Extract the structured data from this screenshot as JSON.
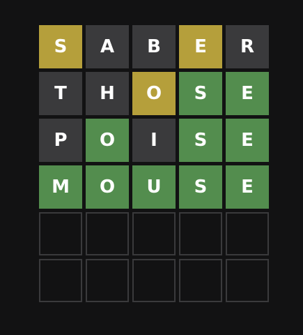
{
  "colors": {
    "correct": "#538d4e",
    "present": "#b59f3b",
    "absent": "#3a3a3c",
    "background": "#121213",
    "empty_border": "#3a3a3c"
  },
  "board": {
    "rows": [
      [
        {
          "letter": "S",
          "state": "present"
        },
        {
          "letter": "A",
          "state": "absent"
        },
        {
          "letter": "B",
          "state": "absent"
        },
        {
          "letter": "E",
          "state": "present"
        },
        {
          "letter": "R",
          "state": "absent"
        }
      ],
      [
        {
          "letter": "T",
          "state": "absent"
        },
        {
          "letter": "H",
          "state": "absent"
        },
        {
          "letter": "O",
          "state": "present"
        },
        {
          "letter": "S",
          "state": "correct"
        },
        {
          "letter": "E",
          "state": "correct"
        }
      ],
      [
        {
          "letter": "P",
          "state": "absent"
        },
        {
          "letter": "O",
          "state": "correct"
        },
        {
          "letter": "I",
          "state": "absent"
        },
        {
          "letter": "S",
          "state": "correct"
        },
        {
          "letter": "E",
          "state": "correct"
        }
      ],
      [
        {
          "letter": "M",
          "state": "correct"
        },
        {
          "letter": "O",
          "state": "correct"
        },
        {
          "letter": "U",
          "state": "correct"
        },
        {
          "letter": "S",
          "state": "correct"
        },
        {
          "letter": "E",
          "state": "correct"
        }
      ],
      [
        {
          "letter": "",
          "state": "empty"
        },
        {
          "letter": "",
          "state": "empty"
        },
        {
          "letter": "",
          "state": "empty"
        },
        {
          "letter": "",
          "state": "empty"
        },
        {
          "letter": "",
          "state": "empty"
        }
      ],
      [
        {
          "letter": "",
          "state": "empty"
        },
        {
          "letter": "",
          "state": "empty"
        },
        {
          "letter": "",
          "state": "empty"
        },
        {
          "letter": "",
          "state": "empty"
        },
        {
          "letter": "",
          "state": "empty"
        }
      ]
    ]
  }
}
